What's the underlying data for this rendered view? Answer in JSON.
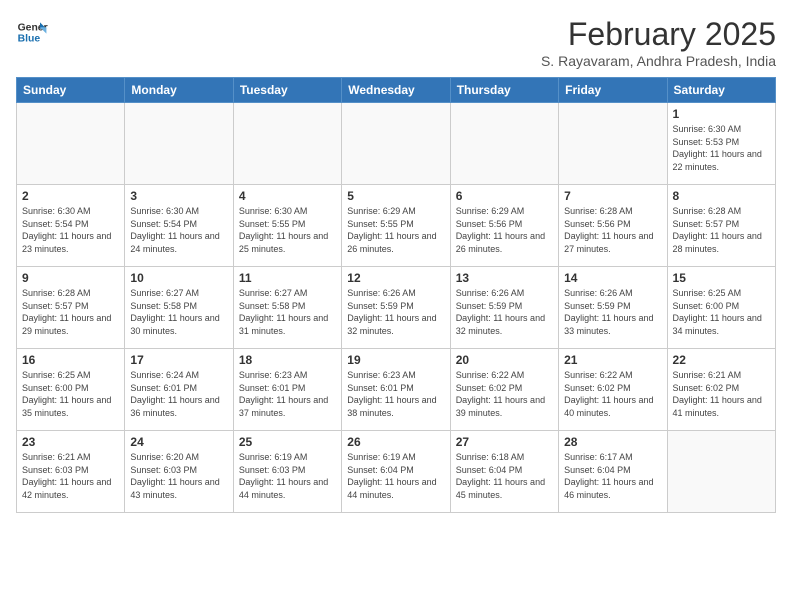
{
  "header": {
    "logo_line1": "General",
    "logo_line2": "Blue",
    "month": "February 2025",
    "location": "S. Rayavaram, Andhra Pradesh, India"
  },
  "weekdays": [
    "Sunday",
    "Monday",
    "Tuesday",
    "Wednesday",
    "Thursday",
    "Friday",
    "Saturday"
  ],
  "weeks": [
    [
      {
        "day": "",
        "info": ""
      },
      {
        "day": "",
        "info": ""
      },
      {
        "day": "",
        "info": ""
      },
      {
        "day": "",
        "info": ""
      },
      {
        "day": "",
        "info": ""
      },
      {
        "day": "",
        "info": ""
      },
      {
        "day": "1",
        "info": "Sunrise: 6:30 AM\nSunset: 5:53 PM\nDaylight: 11 hours and 22 minutes."
      }
    ],
    [
      {
        "day": "2",
        "info": "Sunrise: 6:30 AM\nSunset: 5:54 PM\nDaylight: 11 hours and 23 minutes."
      },
      {
        "day": "3",
        "info": "Sunrise: 6:30 AM\nSunset: 5:54 PM\nDaylight: 11 hours and 24 minutes."
      },
      {
        "day": "4",
        "info": "Sunrise: 6:30 AM\nSunset: 5:55 PM\nDaylight: 11 hours and 25 minutes."
      },
      {
        "day": "5",
        "info": "Sunrise: 6:29 AM\nSunset: 5:55 PM\nDaylight: 11 hours and 26 minutes."
      },
      {
        "day": "6",
        "info": "Sunrise: 6:29 AM\nSunset: 5:56 PM\nDaylight: 11 hours and 26 minutes."
      },
      {
        "day": "7",
        "info": "Sunrise: 6:28 AM\nSunset: 5:56 PM\nDaylight: 11 hours and 27 minutes."
      },
      {
        "day": "8",
        "info": "Sunrise: 6:28 AM\nSunset: 5:57 PM\nDaylight: 11 hours and 28 minutes."
      }
    ],
    [
      {
        "day": "9",
        "info": "Sunrise: 6:28 AM\nSunset: 5:57 PM\nDaylight: 11 hours and 29 minutes."
      },
      {
        "day": "10",
        "info": "Sunrise: 6:27 AM\nSunset: 5:58 PM\nDaylight: 11 hours and 30 minutes."
      },
      {
        "day": "11",
        "info": "Sunrise: 6:27 AM\nSunset: 5:58 PM\nDaylight: 11 hours and 31 minutes."
      },
      {
        "day": "12",
        "info": "Sunrise: 6:26 AM\nSunset: 5:59 PM\nDaylight: 11 hours and 32 minutes."
      },
      {
        "day": "13",
        "info": "Sunrise: 6:26 AM\nSunset: 5:59 PM\nDaylight: 11 hours and 32 minutes."
      },
      {
        "day": "14",
        "info": "Sunrise: 6:26 AM\nSunset: 5:59 PM\nDaylight: 11 hours and 33 minutes."
      },
      {
        "day": "15",
        "info": "Sunrise: 6:25 AM\nSunset: 6:00 PM\nDaylight: 11 hours and 34 minutes."
      }
    ],
    [
      {
        "day": "16",
        "info": "Sunrise: 6:25 AM\nSunset: 6:00 PM\nDaylight: 11 hours and 35 minutes."
      },
      {
        "day": "17",
        "info": "Sunrise: 6:24 AM\nSunset: 6:01 PM\nDaylight: 11 hours and 36 minutes."
      },
      {
        "day": "18",
        "info": "Sunrise: 6:23 AM\nSunset: 6:01 PM\nDaylight: 11 hours and 37 minutes."
      },
      {
        "day": "19",
        "info": "Sunrise: 6:23 AM\nSunset: 6:01 PM\nDaylight: 11 hours and 38 minutes."
      },
      {
        "day": "20",
        "info": "Sunrise: 6:22 AM\nSunset: 6:02 PM\nDaylight: 11 hours and 39 minutes."
      },
      {
        "day": "21",
        "info": "Sunrise: 6:22 AM\nSunset: 6:02 PM\nDaylight: 11 hours and 40 minutes."
      },
      {
        "day": "22",
        "info": "Sunrise: 6:21 AM\nSunset: 6:02 PM\nDaylight: 11 hours and 41 minutes."
      }
    ],
    [
      {
        "day": "23",
        "info": "Sunrise: 6:21 AM\nSunset: 6:03 PM\nDaylight: 11 hours and 42 minutes."
      },
      {
        "day": "24",
        "info": "Sunrise: 6:20 AM\nSunset: 6:03 PM\nDaylight: 11 hours and 43 minutes."
      },
      {
        "day": "25",
        "info": "Sunrise: 6:19 AM\nSunset: 6:03 PM\nDaylight: 11 hours and 44 minutes."
      },
      {
        "day": "26",
        "info": "Sunrise: 6:19 AM\nSunset: 6:04 PM\nDaylight: 11 hours and 44 minutes."
      },
      {
        "day": "27",
        "info": "Sunrise: 6:18 AM\nSunset: 6:04 PM\nDaylight: 11 hours and 45 minutes."
      },
      {
        "day": "28",
        "info": "Sunrise: 6:17 AM\nSunset: 6:04 PM\nDaylight: 11 hours and 46 minutes."
      },
      {
        "day": "",
        "info": ""
      }
    ]
  ]
}
